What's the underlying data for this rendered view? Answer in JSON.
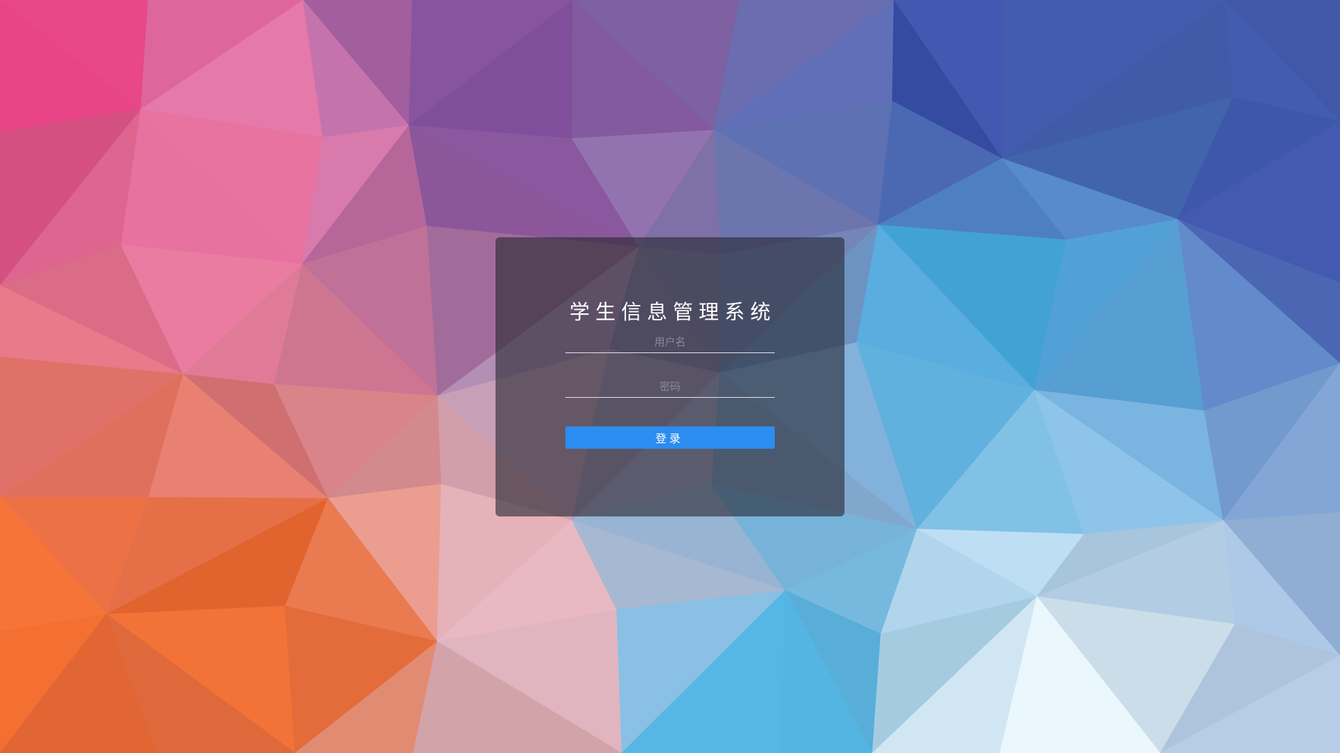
{
  "background": {
    "description_name": "low-poly-gradient-background",
    "colors": {
      "magenta": "#e8307a",
      "pink": "#f07aa8",
      "orange": "#f06a2a",
      "purple": "#8a5aa8",
      "blue": "#3a50a8",
      "sky": "#4ab8e8",
      "pale": "#e8f4f8"
    }
  },
  "login": {
    "title": "学生信息管理系统",
    "username_placeholder": "用户名",
    "username_value": "",
    "password_placeholder": "密码",
    "password_value": "",
    "submit_label": "登录"
  },
  "colors": {
    "card_bg": "rgba(40,42,52,0.62)",
    "button_accent": "#2d8cf0",
    "title_text": "#ffffff"
  }
}
